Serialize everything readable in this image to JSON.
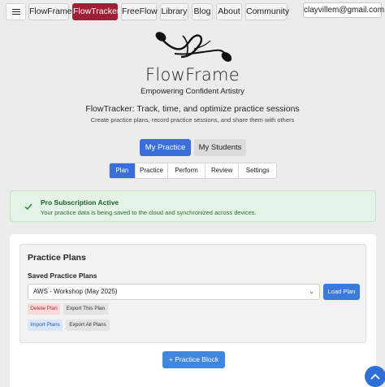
{
  "nav": {
    "menu_icon": "hamburger-icon",
    "links": [
      {
        "label": "FlowFrame",
        "active": false
      },
      {
        "label": "FlowTracker",
        "active": true
      },
      {
        "label": "FreeFlow",
        "active": false
      },
      {
        "label": "Library",
        "active": false
      },
      {
        "label": "Blog",
        "active": false
      },
      {
        "label": "About",
        "active": false
      },
      {
        "label": "Community",
        "active": false
      }
    ],
    "user_email": "clayvillem@gmail.com",
    "active_color": "#9e2036"
  },
  "brand": {
    "name": "FlowFrame",
    "tagline": "Empowering Confident Artistry",
    "logo_icon": "flowframe-logo"
  },
  "app": {
    "title": "FlowTracker: Track, time, and optimize practice sessions",
    "subtitle": "Create practice plans, record practice sessions, and share them with others"
  },
  "view_toggle": {
    "options": [
      {
        "label": "My Practice",
        "active": true
      },
      {
        "label": "My Students",
        "active": false
      }
    ]
  },
  "tabs": [
    {
      "label": "Plan",
      "active": true
    },
    {
      "label": "Practice",
      "active": false
    },
    {
      "label": "Perform",
      "active": false
    },
    {
      "label": "Review",
      "active": false
    },
    {
      "label": "Settings",
      "active": false
    }
  ],
  "alert": {
    "icon": "check-circle-icon",
    "title": "Pro Subscription Active",
    "message": "Your practice data is being saved to the cloud and synchronized across devices."
  },
  "plans": {
    "section_title": "Practice Plans",
    "saved_label": "Saved Practice Plans",
    "selected_plan": "AWS - Workshop (May 2025)",
    "load_button": "Load Plan",
    "delete_button": "Delete Plan",
    "export_button": "Export This Plan",
    "import_button": "Import Plans",
    "export_all_button": "Export All Plans"
  },
  "add_block_button": "+ Practice Block",
  "colors": {
    "primary_blue": "#3b6fd8",
    "success_bg": "#e4f3e6",
    "danger_text": "#b22a2a"
  }
}
